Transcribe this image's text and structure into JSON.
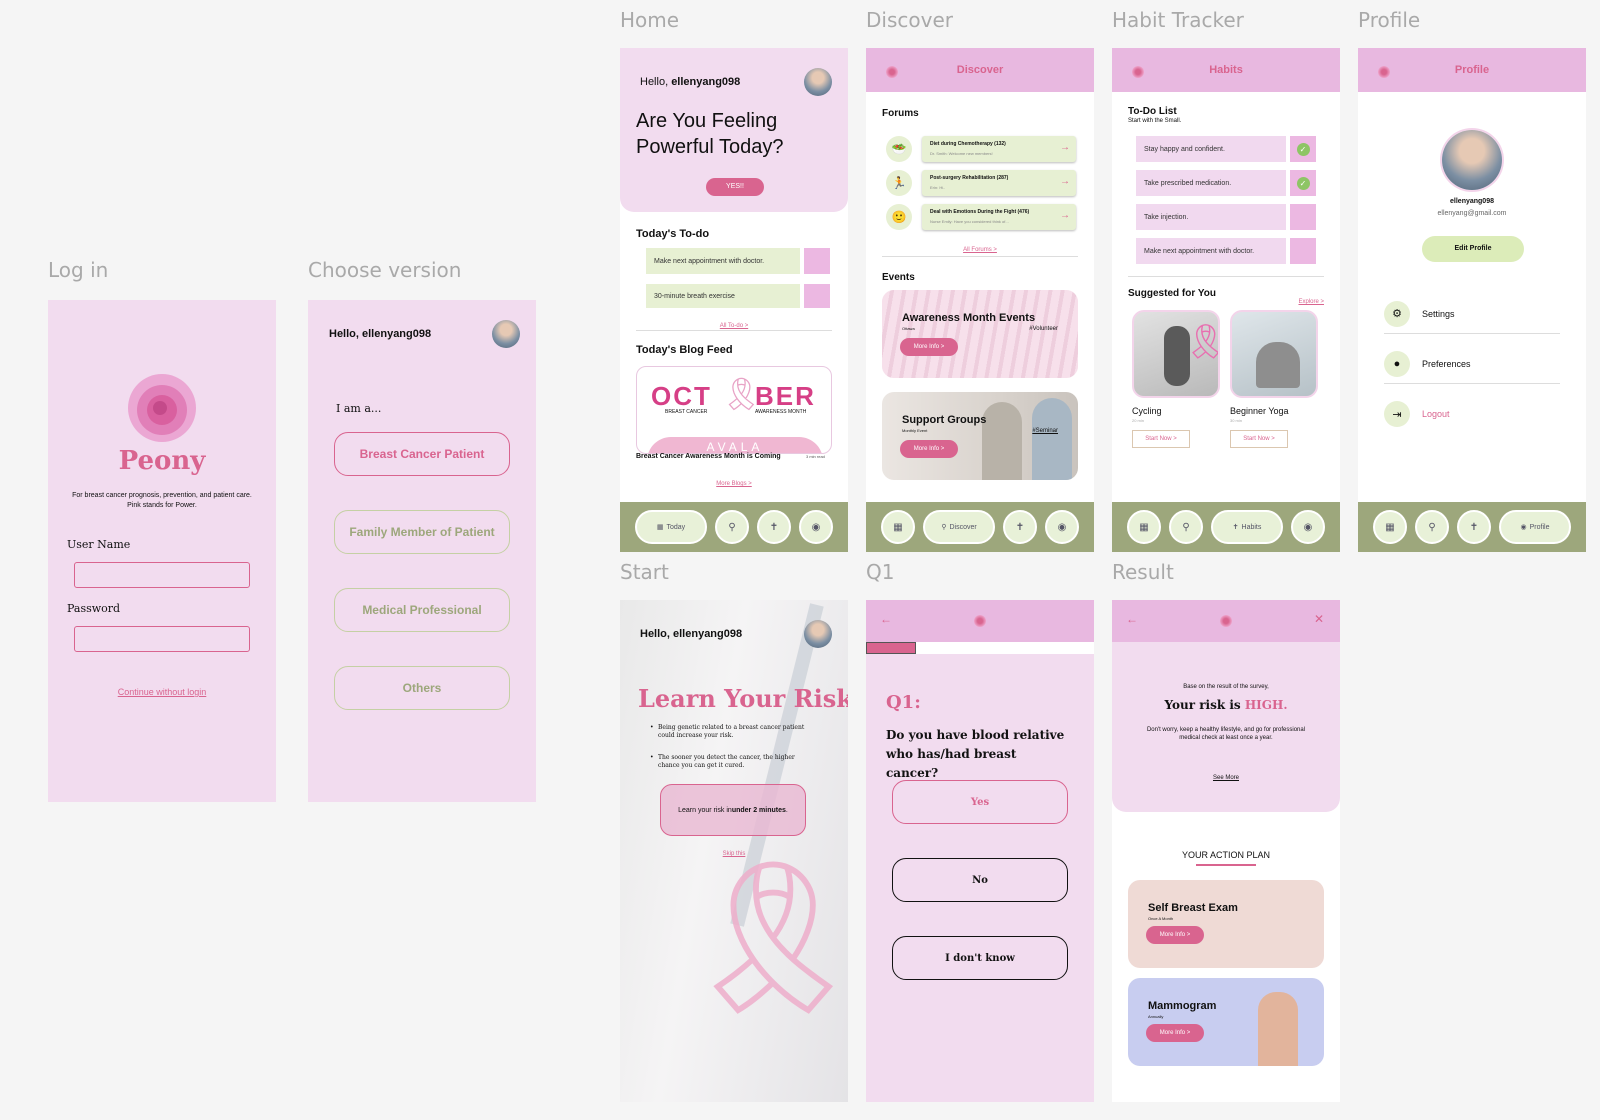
{
  "labels": {
    "login": "Log in",
    "choose": "Choose version",
    "home": "Home",
    "discover": "Discover",
    "habit": "Habit Tracker",
    "profile": "Profile",
    "start": "Start",
    "q1": "Q1",
    "result": "Result"
  },
  "login": {
    "brand": "Peony",
    "tagline_1": "For breast cancer prognosis, prevention, and patient care.",
    "tagline_2": "Pink stands for Power.",
    "user_label": "User Name",
    "pass_label": "Password",
    "continue": "Continue without login"
  },
  "choose": {
    "greeting": "Hello, ellenyang098",
    "iam": "I am a...",
    "options": [
      "Breast Cancer Patient",
      "Family Member of Patient",
      "Medical Professional",
      "Others"
    ]
  },
  "home": {
    "hello": "Hello, ",
    "username": "ellenyang098",
    "headline": "Are You Feeling Powerful Today?",
    "yes": "YES!!",
    "todo_title": "Today's To-do",
    "todos": [
      "Make next appointment with doctor.",
      "30-minute breath exercise"
    ],
    "all_todo": "All To-do >",
    "blog_title": "Today's Blog Feed",
    "banner_1": "OCT",
    "banner_2": "BER",
    "banner_sub_left": "BREAST CANCER",
    "banner_sub_right": "AWARENESS MONTH",
    "banner_bottom": "AVALA",
    "blog_caption": "Breast Cancer Awareness Month is Coming",
    "read_time": "3 min read",
    "more_blogs": "More Blogs >",
    "nav_today": "Today"
  },
  "discover": {
    "title": "Discover",
    "forums_title": "Forums",
    "forums": [
      {
        "title": "Diet during Chemotherapy (132)",
        "sub": "Dr. Smith: Welcome new members!"
      },
      {
        "title": "Post-surgery Rehabilitation (287)",
        "sub": "Erin: Hi.."
      },
      {
        "title": "Deal with Emotions During the Fight (476)",
        "sub": "Nurse Emily: Have you considered think of..."
      }
    ],
    "all_forums": "All Forums >",
    "events_title": "Events",
    "event1_title": "Awareness Month Events",
    "event1_sub": "Ottawa",
    "event1_tag": "#Volunteer",
    "event2_title": "Support Groups",
    "event2_sub": "Monthly Event",
    "event2_tag": "#Seminar",
    "more_info": "More Info >",
    "nav_label": "Discover"
  },
  "habits": {
    "title": "Habits",
    "todo_title": "To-Do List",
    "todo_sub": "Start with the Small.",
    "items": [
      "Stay happy and confident.",
      "Take prescribed medication.",
      "Take injection.",
      "Make next appointment with doctor."
    ],
    "suggested": "Suggested for You",
    "explore": "Explore >",
    "s1_name": "Cycling",
    "s1_time": "20 min",
    "s2_name": "Beginner Yoga",
    "s2_time": "30 min",
    "start_now": "Start Now >",
    "nav_label": "Habits"
  },
  "profile": {
    "title": "Profile",
    "username": "ellenyang098",
    "email": "ellenyang@gmail.com",
    "edit": "Edit Profile",
    "settings": "Settings",
    "preferences": "Preferences",
    "logout": "Logout",
    "nav_label": "Profile"
  },
  "start": {
    "greeting": "Hello, ellenyang098",
    "title": "Learn Your Risk",
    "bullet1": "Being genetic related to a breast cancer patient could increase your risk.",
    "bullet2": "The sooner you detect the cancer, the higher chance you can get it cured.",
    "cta_pre": "Learn your risk in ",
    "cta_bold": "under 2 minutes",
    "cta_post": ".",
    "skip": "Skip this"
  },
  "q1": {
    "label": "Q1:",
    "question": "Do you have blood relative who has/had breast cancer?",
    "yes": "Yes",
    "no": "No",
    "dk": "I don't know",
    "progress": 0.22
  },
  "result": {
    "base": "Base on the result of the survey,",
    "risk_pre": "Your risk is ",
    "risk": "HIGH.",
    "advice": "Don't worry, keep a healthy lifestyle, and go for professional medical check at least once a year.",
    "see_more": "See More",
    "plan_title": "YOUR ACTION PLAN",
    "plan1": "Self Breast Exam",
    "plan1_sub": "Once A Month",
    "plan2": "Mammogram",
    "plan2_sub": "Annually",
    "more_info": "More Info >"
  },
  "colors": {
    "accent": "#d9648f",
    "pink_bg": "#f2dcef",
    "header": "#e8b8e0",
    "nav": "#9da77c",
    "green_soft": "#e7f0d3"
  }
}
